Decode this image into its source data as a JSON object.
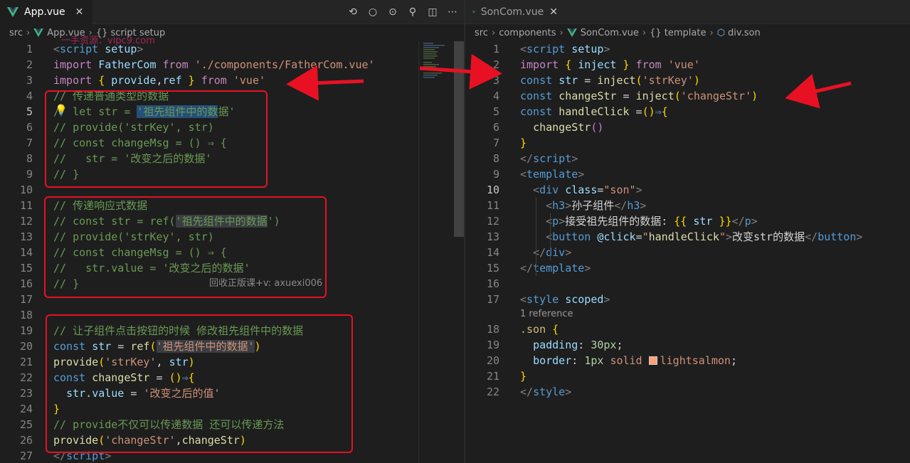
{
  "left": {
    "tab": {
      "title": "App.vue",
      "close": "✕"
    },
    "actions": [
      "⟲",
      "○",
      "⊙",
      "⚲",
      "◫",
      "⋯"
    ],
    "breadcrumb": {
      "folder": "src",
      "file": "App.vue",
      "symbol": "{} script setup"
    },
    "lines": [
      {
        "n": "1",
        "html": "<span class='pn'>&lt;</span><span class='tg'>script</span> <span class='at'>setup</span><span class='pn'>&gt;</span>"
      },
      {
        "n": "2",
        "html": "<span class='kw2'>import</span> <span class='vr'>FatherCom</span> <span class='kw2'>from</span> <span class='st'>'./components/FatherCom.vue'</span>"
      },
      {
        "n": "3",
        "html": "<span class='kw2'>import</span> <span class='br'>{</span> <span class='vr'>provide</span>,<span class='vr'>ref</span> <span class='br'>}</span> <span class='kw2'>from</span> <span class='st'>'vue'</span>"
      },
      {
        "n": "4",
        "html": "<span class='cm'>// 传递普通类型的数据</span>"
      },
      {
        "n": "5",
        "html": "<span class='cm'>// let str = <span class='sel'>'祖先组件中的数</span>据'</span>",
        "cur": true
      },
      {
        "n": "6",
        "html": "<span class='cm'>// provide('strKey', str)</span>"
      },
      {
        "n": "7",
        "html": "<span class='cm'>// const changeMsg = () ⇒ {</span>"
      },
      {
        "n": "8",
        "html": "<span class='cm'>//   str = '改变之后的数据'</span>"
      },
      {
        "n": "9",
        "html": "<span class='cm'>// }</span>"
      },
      {
        "n": "10",
        "html": ""
      },
      {
        "n": "11",
        "html": "<span class='cm'>// 传递响应式数据</span>"
      },
      {
        "n": "12",
        "html": "<span class='cm'>// const str = ref(<span class='hl'>'祖先组件中的数据</span>')</span>"
      },
      {
        "n": "13",
        "html": "<span class='cm'>// provide('strKey', str)</span>"
      },
      {
        "n": "14",
        "html": "<span class='cm'>// const changeMsg = () ⇒ {</span>"
      },
      {
        "n": "15",
        "html": "<span class='cm'>//   str.value = '改变之后的数据'</span>"
      },
      {
        "n": "16",
        "html": "<span class='cm'>// }</span>"
      },
      {
        "n": "17",
        "html": ""
      },
      {
        "n": "18",
        "html": ""
      },
      {
        "n": "19",
        "html": "<span class='cm'>// 让子组件点击按钮的时候 修改祖先组件中的数据</span>"
      },
      {
        "n": "20",
        "html": "<span class='kw'>const</span> <span class='vr'>str</span> = <span class='fn'>ref</span><span class='br'>(</span><span class='st hl'>'祖先组件中的数据'</span><span class='br'>)</span>"
      },
      {
        "n": "21",
        "html": "<span class='fn'>provide</span><span class='br'>(</span><span class='st'>'strKey'</span>, <span class='vr'>str</span><span class='br'>)</span>"
      },
      {
        "n": "22",
        "html": "<span class='kw'>const</span> <span class='fn'>changeStr</span> = <span class='br'>()</span><span class='kw'>⇒</span><span class='br'>{</span>"
      },
      {
        "n": "23",
        "html": "  <span class='vr'>str</span>.<span class='vr'>value</span> = <span class='st'>'改变之后的值'</span>"
      },
      {
        "n": "24",
        "html": "<span class='br'>}</span>"
      },
      {
        "n": "25",
        "html": "<span class='cm'>// provide不仅可以传递数据 还可以传递方法</span>"
      },
      {
        "n": "26",
        "html": "<span class='fn'>provide</span><span class='br'>(</span><span class='st'>'changeStr'</span>,<span class='fn'>changeStr</span><span class='br'>)</span>"
      },
      {
        "n": "27",
        "html": "<span class='pn'>&lt;/</span><span class='tg'>script</span><span class='pn'>&gt;</span>"
      }
    ],
    "watermark_top": "一手资源：vipc9.com",
    "watermark_mid": "回收正版课+v: axuexi006"
  },
  "right": {
    "tab": {
      "title": "SonCom.vue",
      "close": "✕"
    },
    "breadcrumb": {
      "a": "src",
      "b": "components",
      "c": "SonCom.vue",
      "d": "{} template",
      "e": "div.son"
    },
    "reference": "1 reference",
    "lines": [
      {
        "n": "1",
        "html": "<span class='pn'>&lt;</span><span class='tg'>script</span> <span class='at'>setup</span><span class='pn'>&gt;</span>"
      },
      {
        "n": "2",
        "html": "<span class='kw2'>import</span> <span class='br'>{</span> <span class='vr'>inject</span> <span class='br'>}</span> <span class='kw2'>from</span> <span class='st'>'vue'</span>"
      },
      {
        "n": "3",
        "html": "<span class='kw'>const</span> <span class='vr'>str</span> = <span class='fn'>inject</span><span class='br'>(</span><span class='st'>'strKey'</span><span class='br'>)</span>"
      },
      {
        "n": "4",
        "html": "<span class='kw'>const</span> <span class='fn'>changeStr</span> = <span class='fn'>inject</span><span class='br'>(</span><span class='st'>'changeStr'</span><span class='br'>)</span>"
      },
      {
        "n": "5",
        "html": "<span class='kw'>const</span> <span class='fn'>handleClick</span> =<span class='br'>()</span><span class='kw'>⇒</span><span class='br'>{</span>"
      },
      {
        "n": "6",
        "html": "  <span class='fn'>changeStr</span><span class='br2'>()</span>"
      },
      {
        "n": "7",
        "html": "<span class='br'>}</span>"
      },
      {
        "n": "8",
        "html": "<span class='pn'>&lt;/</span><span class='tg'>script</span><span class='pn'>&gt;</span>"
      },
      {
        "n": "9",
        "html": "<span class='pn'>&lt;</span><span class='tg'>template</span><span class='pn'>&gt;</span>"
      },
      {
        "n": "10",
        "html": "  <span class='pn'>&lt;</span><span class='tg'>div</span> <span class='at'>class</span>=<span class='st'>\"son\"</span><span class='pn'>&gt;</span>",
        "cur": true
      },
      {
        "n": "11",
        "html": "    <span class='pn'>&lt;</span><span class='tg'>h3</span><span class='pn'>&gt;</span>孙子组件<span class='pn'>&lt;/</span><span class='tg'>h3</span><span class='pn'>&gt;</span>"
      },
      {
        "n": "12",
        "html": "    <span class='pn'>&lt;</span><span class='tg'>p</span><span class='pn'>&gt;</span>接受祖先组件的数据: <span class='br'>{{</span> <span class='vr'>str</span> <span class='br'>}}</span><span class='pn'>&lt;/</span><span class='tg'>p</span><span class='pn'>&gt;</span>"
      },
      {
        "n": "13",
        "html": "    <span class='pn'>&lt;</span><span class='tg'>button</span> <span class='at'>@click</span>=<span class='st'>\"</span><span class='fn'>handleClick</span><span class='st'>\"</span><span class='pn'>&gt;</span>改变str的数据<span class='pn'>&lt;/</span><span class='tg'>button</span><span class='pn'>&gt;</span>"
      },
      {
        "n": "14",
        "html": "  <span class='pn'>&lt;/</span><span class='tg'>div</span><span class='pn'>&gt;</span>"
      },
      {
        "n": "15",
        "html": "<span class='pn'>&lt;/</span><span class='tg'>template</span><span class='pn'>&gt;</span>"
      },
      {
        "n": "16",
        "html": ""
      },
      {
        "n": "17",
        "html": "<span class='pn'>&lt;</span><span class='tg'>style</span> <span class='at'>scoped</span><span class='pn'>&gt;</span>"
      },
      {
        "n": "18",
        "html": "<span class='cls'>.son</span> <span class='br'>{</span>"
      },
      {
        "n": "19",
        "html": "  <span class='prop'>padding</span>: <span class='nm'>30px</span>;"
      },
      {
        "n": "20",
        "html": "  <span class='prop'>border</span>: <span class='nm'>1px</span> <span class='st'>solid</span> <span class='swatch'></span><span class='st'>lightsalmon</span>;"
      },
      {
        "n": "21",
        "html": "<span class='br'>}</span>"
      },
      {
        "n": "22",
        "html": "<span class='pn'>&lt;/</span><span class='tg'>style</span><span class='pn'>&gt;</span>"
      }
    ]
  },
  "colors": {
    "annotation": "#e81123",
    "vue_green": "#41b883",
    "vue_dark": "#35495e"
  }
}
